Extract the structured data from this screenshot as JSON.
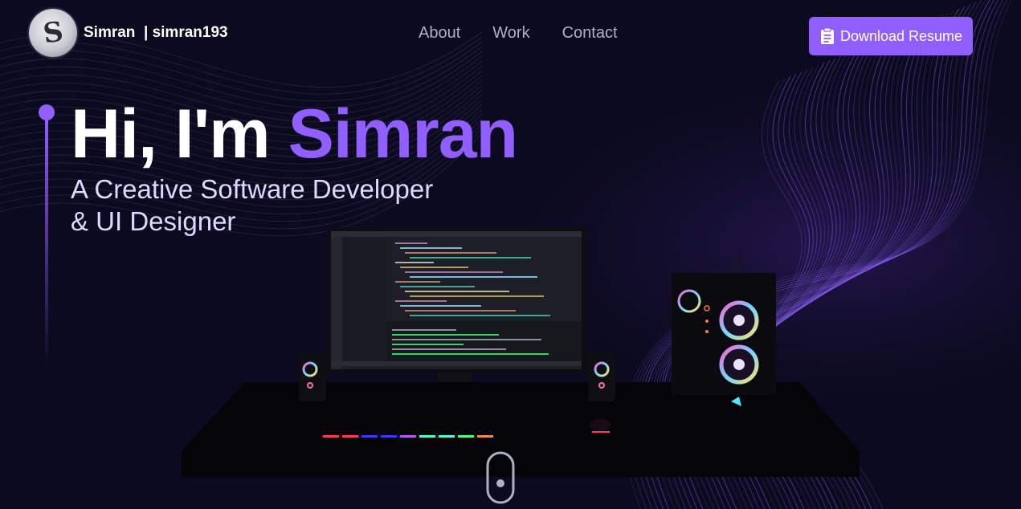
{
  "brand": {
    "name": "Simran",
    "separator": "  | ",
    "handle": "simran193",
    "avatar_letter": "S"
  },
  "nav": {
    "items": [
      {
        "label": "About"
      },
      {
        "label": "Work"
      },
      {
        "label": "Contact"
      }
    ]
  },
  "cta": {
    "label": "Download Resume",
    "icon": "clipboard-icon"
  },
  "hero": {
    "greeting": "Hi, I'm ",
    "name": "Simran",
    "subtitle_line1": "A Creative Software Developer",
    "subtitle_line2": "& UI Designer"
  },
  "colors": {
    "accent": "#915eff",
    "background": "#0b0a1e",
    "muted_text": "#aeb0c6",
    "subtitle_text": "#dfd9ff"
  }
}
